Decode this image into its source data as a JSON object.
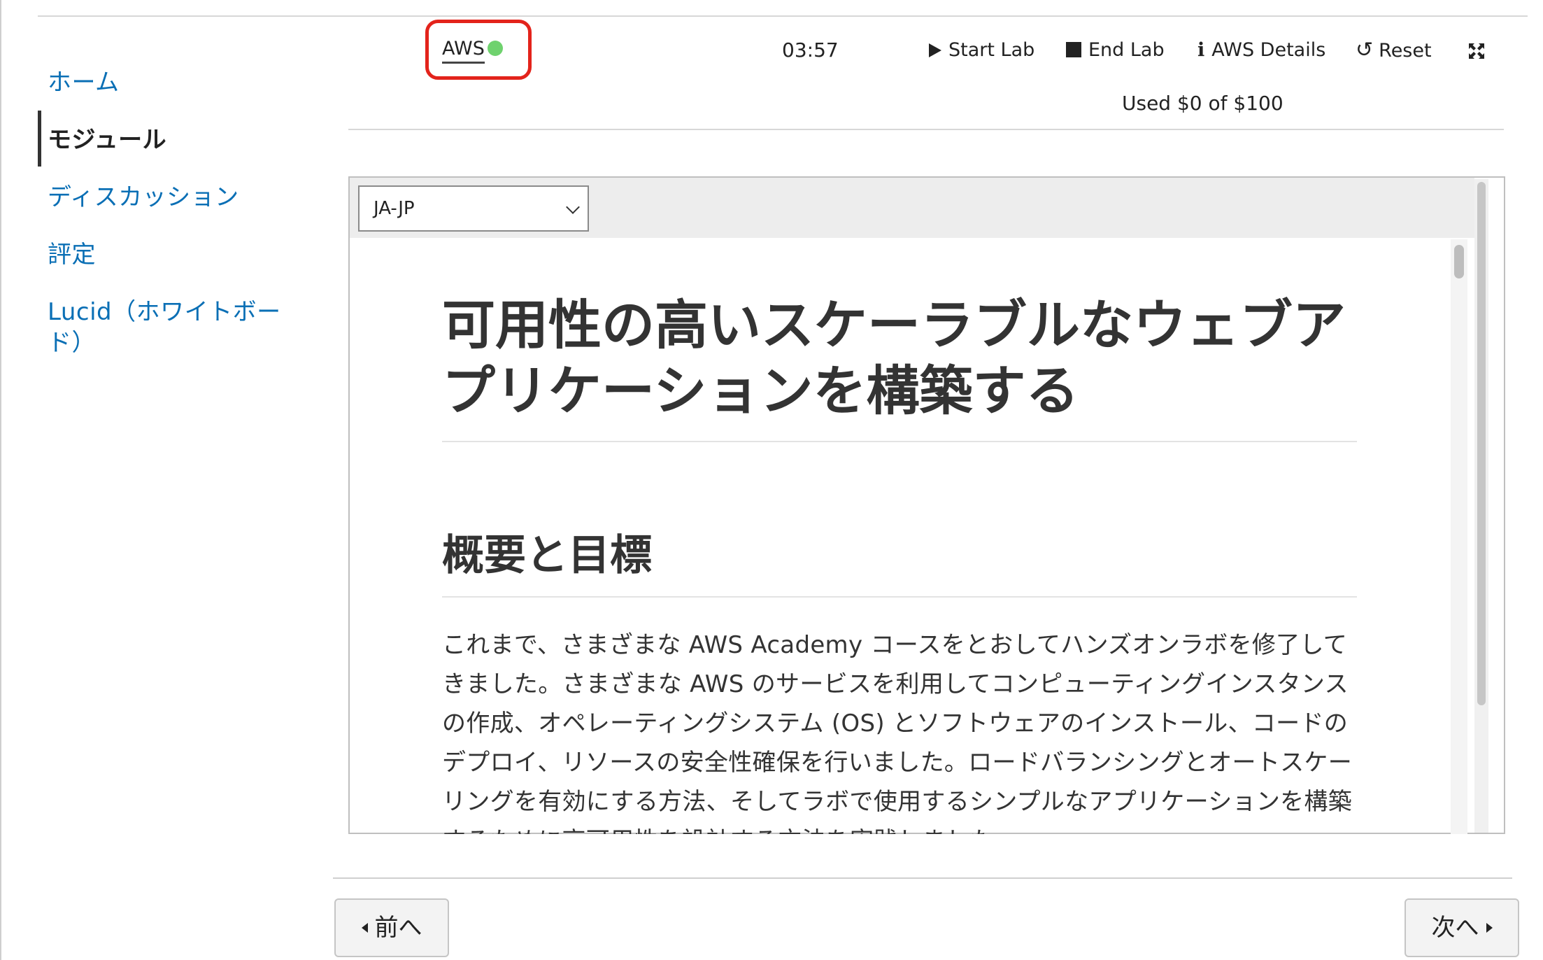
{
  "sidebar": {
    "items": [
      {
        "label": "ホーム"
      },
      {
        "label": "モジュール",
        "active": true
      },
      {
        "label": "ディスカッション"
      },
      {
        "label": "評定"
      },
      {
        "label": "Lucid（ホワイトボー\nド）"
      }
    ]
  },
  "header": {
    "aws_label": "AWS",
    "aws_status_color": "#6fd26e",
    "timer": "03:57",
    "start_lab": "Start Lab",
    "end_lab": "End Lab",
    "aws_details": "AWS Details",
    "reset": "Reset",
    "budget": "Used $0 of $100",
    "expand_icon": "expand-icon"
  },
  "content": {
    "language": "JA-JP",
    "title": "可用性の高いスケーラブルなウェブアプリケーションを構築する",
    "section_heading": "概要と目標",
    "paragraph": "これまで、さまざまな AWS Academy コースをとおしてハンズオンラボを修了してきました。さまざまな AWS のサービスを利用してコンピューティングインスタンスの作成、オペレーティングシステム (OS) とソフトウェアのインストール、コードのデプロイ、リソースの安全性確保を行いました。ロードバランシングとオートスケーリングを有効にする方法、そしてラボで使用するシンプルなアプリケーションを構築するために高可用性を設計する方法を実践しました。"
  },
  "footer": {
    "prev": "前へ",
    "next": "次へ"
  },
  "colors": {
    "link": "#0a6fb5",
    "highlight_box": "#e3231b"
  }
}
